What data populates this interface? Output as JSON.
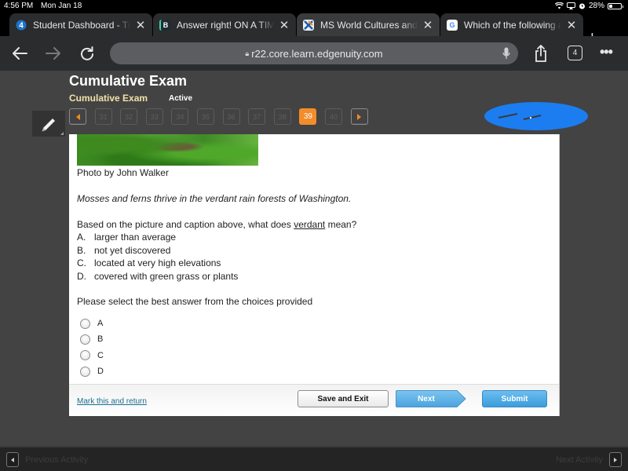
{
  "status_bar": {
    "time": "4:56 PM",
    "date": "Mon Jan 18",
    "battery_percent": "28%",
    "battery_level": 0.28
  },
  "browser": {
    "tabs": [
      {
        "title": "Student Dashboard - Tim",
        "favicon": "edgenuity-4-icon",
        "favicon_glyph": "4",
        "favicon_color": "#1e73c9"
      },
      {
        "title": "Answer right! ON A TIME",
        "favicon": "brainly-icon",
        "favicon_glyph": "B",
        "favicon_color": "#1f2b33"
      },
      {
        "title": "MS World Cultures and G",
        "favicon": "course-x-icon",
        "favicon_glyph": "✕",
        "favicon_color": "#e8f0f8"
      },
      {
        "title": "Which of the following an",
        "favicon": "google-icon",
        "favicon_glyph": "G",
        "favicon_color": "#ffffff"
      }
    ],
    "url": "r22.core.learn.edgenuity.com",
    "tab_count": "4"
  },
  "exam": {
    "title": "Cumulative Exam",
    "subtitle": "Cumulative Exam",
    "status": "Active",
    "question_numbers": [
      "31",
      "32",
      "33",
      "34",
      "35",
      "36",
      "37",
      "38",
      "39",
      "40"
    ],
    "current_question": "39"
  },
  "question": {
    "photo_credit": "Photo by John Walker",
    "caption": "Mosses and ferns thrive in the verdant rain forests of Washington.",
    "prompt_before": "Based on the picture and caption above, what does ",
    "prompt_word": "verdant",
    "prompt_after": " mean?",
    "choices": [
      {
        "letter": "A.",
        "text": "larger than average"
      },
      {
        "letter": "B.",
        "text": "not yet discovered"
      },
      {
        "letter": "C.",
        "text": "located at very high elevations"
      },
      {
        "letter": "D.",
        "text": "covered with green grass or plants"
      }
    ],
    "instruction": "Please select the best answer from the choices provided",
    "options": [
      "A",
      "B",
      "C",
      "D"
    ]
  },
  "footer": {
    "mark_link": "Mark this and return",
    "save_exit": "Save and Exit",
    "next": "Next",
    "submit": "Submit"
  },
  "activity_bar": {
    "previous": "Previous Activity",
    "next": "Next Activity"
  },
  "colors": {
    "accent_orange": "#f28d2a",
    "button_blue": "#4aa8e3",
    "redaction_blue": "#1c7df0"
  }
}
